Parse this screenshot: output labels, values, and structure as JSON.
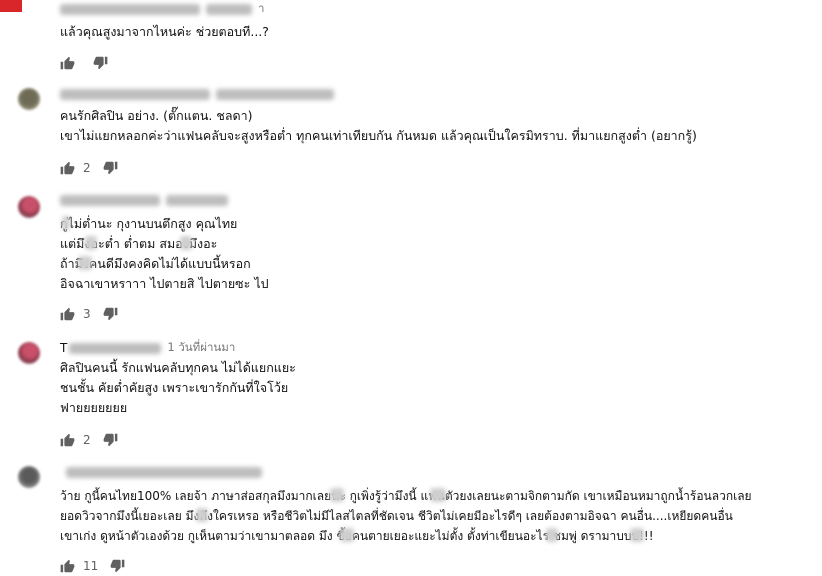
{
  "comments": [
    {
      "time": "",
      "time_fragment": "า",
      "lines": [
        "แล้วคุณสูงมาจากไหนค่ะ ช่วยตอบที...?"
      ],
      "likes": ""
    },
    {
      "time": "",
      "lines": [
        "คนรักศิลปิน อย่าง. (ตั๊กแตน. ชลดา)",
        "เขาไม่แยกหลอกค่ะว่าแฟนคลับจะสูงหรือต่ำ ทุกคนเท่าเทียบกัน กันหมด แล้วคุณเป็นใครมิทราบ. ที่มาแยกสูงต่ำ (อยากรู้)"
      ],
      "likes": "2"
    },
    {
      "time": "",
      "lines": [
        "กูไม่ต่ำนะ กุงานบนตึกสูง คุณไทย",
        "แต่มึงอะต่ำ ต่ำตม สมองมึงอะ",
        "ถ้ามึงคนดีมึงคงคิดไม่ได้แบบนี้หรอก",
        "อิจฉาเขาหราาา ไปตายสิ ไปตายซะ ไป"
      ],
      "likes": "3"
    },
    {
      "author_initial": "T",
      "time": "1 วันที่ผ่านมา",
      "lines": [
        "ศิลปินคนนี้ รักแฟนคลับทุกคน ไม่ได้แยกแยะ",
        "ชนชั้น คัยต่ำคัยสูง เพราะเขารักกันที่ใจโว้ย",
        "ฟายยยยยยย"
      ],
      "likes": "2"
    },
    {
      "author_initial": "",
      "time": "",
      "lines": [
        "ว้าย  กูนี้คนไทย100%  เลยจ้า ภาษาส่อสกุลมึงมากเลยนะ  กูเพิ่งรู้ว่ามึงนี้ แฟนตัวยงเลยนะตามจิกตามกัด เขาเหมือนหมาถูกน้ำร้อนลวกเลย",
        "ยอดวิวจากมึงนี้เยอะเลย มึงตึงใครเหรอ หรือชีวิตไม่มีไลสไตลที่ชัดเจน  ชีวิตไม่เคยมีอะไรดีๆ เลยต้องตามอิจฉา คนอื่น....เหยียดคนอื่น",
        "เขาเก่ง  ดูหน้าตัวเองด้วย กูเห็นตามว่าเขามาตลอด มึง ขี้อคนตายเยอะแยะไม่ตั้ง  ตั้งท่าเขียนอะไร ชมพู่ ดรามาบบบ!!!"
      ],
      "likes": "11"
    }
  ]
}
